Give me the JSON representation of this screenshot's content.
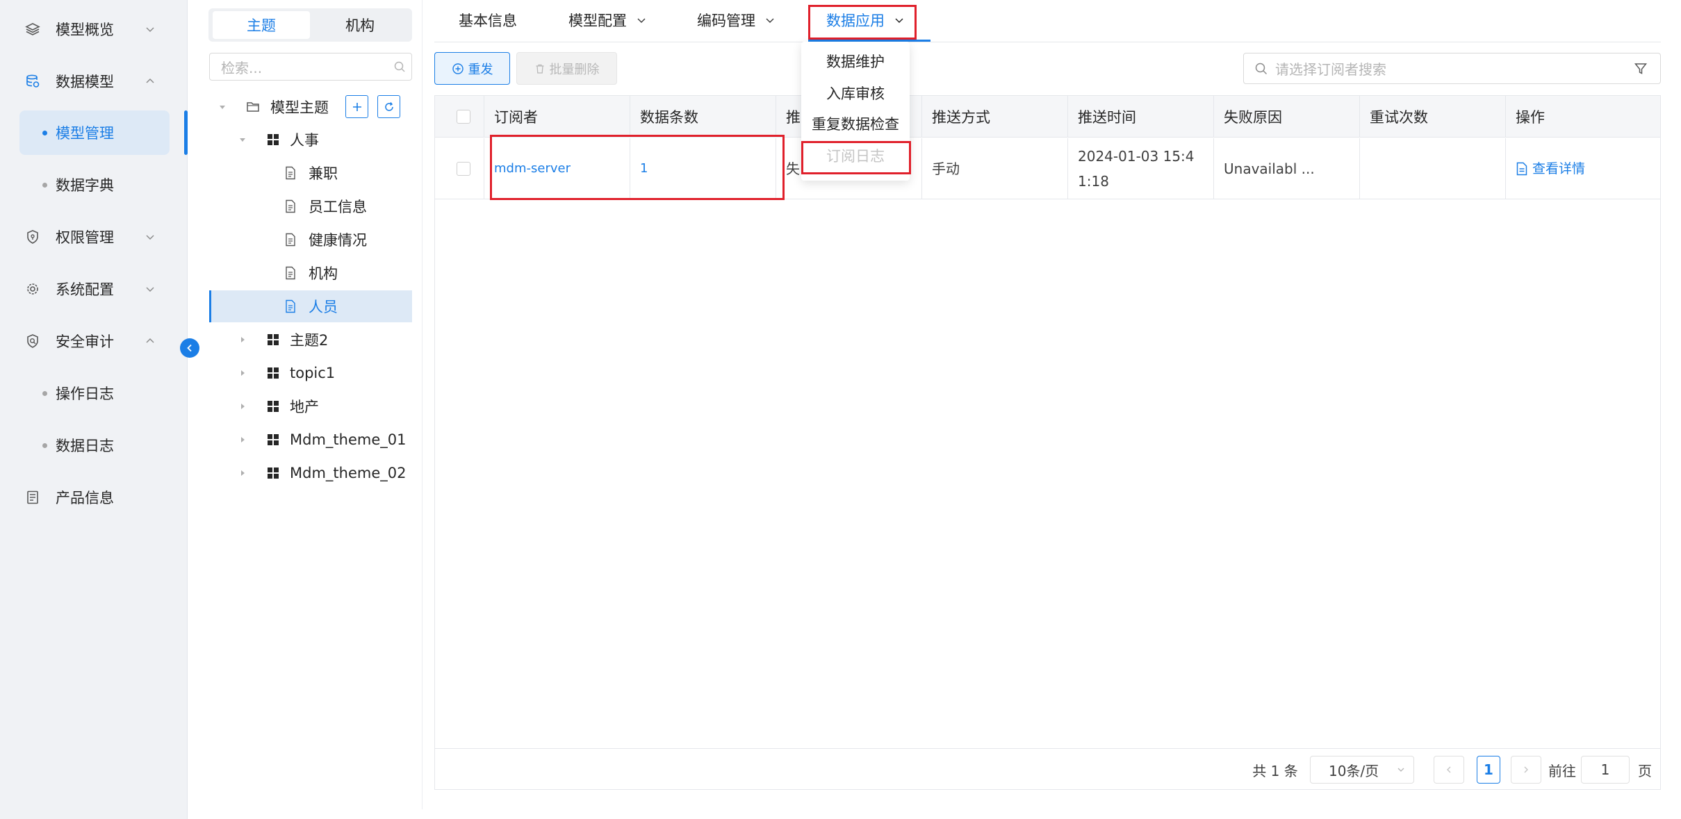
{
  "colors": {
    "primary": "#1b7ee6",
    "highlight_box": "#e0202b",
    "sidebar_bg": "#f0f2f5",
    "selected_bg": "#dde9f6"
  },
  "sidebar": {
    "items": [
      {
        "label": "模型概览",
        "icon": "layers-icon",
        "expanded": false
      },
      {
        "label": "数据模型",
        "icon": "database-icon",
        "expanded": true,
        "children": [
          {
            "label": "模型管理",
            "active": true
          },
          {
            "label": "数据字典"
          }
        ]
      },
      {
        "label": "权限管理",
        "icon": "shield-icon",
        "expanded": false
      },
      {
        "label": "系统配置",
        "icon": "gear-icon",
        "expanded": false
      },
      {
        "label": "安全审计",
        "icon": "security-shield-icon",
        "expanded": true,
        "children": [
          {
            "label": "操作日志"
          },
          {
            "label": "数据日志"
          }
        ]
      },
      {
        "label": "产品信息",
        "icon": "document-list-icon"
      }
    ]
  },
  "tree_panel": {
    "segments": [
      "主题",
      "机构"
    ],
    "active_segment": "主题",
    "search_placeholder": "检索...",
    "root": "模型主题",
    "nodes": [
      {
        "label": "人事",
        "expanded": true,
        "children": [
          "兼职",
          "员工信息",
          "健康情况",
          "机构",
          "人员"
        ]
      },
      {
        "label": "主题2"
      },
      {
        "label": "topic1"
      },
      {
        "label": "地产"
      },
      {
        "label": "Mdm_theme_01"
      },
      {
        "label": "Mdm_theme_02"
      }
    ],
    "selected": "人员"
  },
  "tabs": [
    {
      "label": "基本信息",
      "has_dropdown": false
    },
    {
      "label": "模型配置",
      "has_dropdown": true
    },
    {
      "label": "编码管理",
      "has_dropdown": true
    },
    {
      "label": "数据应用",
      "has_dropdown": true,
      "active": true
    }
  ],
  "dropdown": {
    "items": [
      {
        "label": "数据维护"
      },
      {
        "label": "入库审核"
      },
      {
        "label": "重复数据检查"
      },
      {
        "label": "订阅日志",
        "disabled": true
      }
    ]
  },
  "toolbar": {
    "resend_label": "重发",
    "batch_delete_label": "批量删除",
    "search_placeholder": "请选择订阅者搜索"
  },
  "table": {
    "columns": [
      "订阅者",
      "数据条数",
      "推",
      "推送方式",
      "推送时间",
      "失败原因",
      "重试次数",
      "操作"
    ],
    "rows": [
      {
        "subscriber": "mdm-server",
        "count": "1",
        "status": "失",
        "push_mode": "手动",
        "push_time_line1": "2024-01-03 15:4",
        "push_time_line2": "1:18",
        "fail_reason": "Unavailabl ...",
        "retries": "",
        "action": "查看详情"
      }
    ]
  },
  "pagination": {
    "total": "共 1 条",
    "page_size": "10条/页",
    "current_page": "1",
    "goto_label": "前往",
    "goto_value": "1",
    "page_suffix": "页"
  }
}
